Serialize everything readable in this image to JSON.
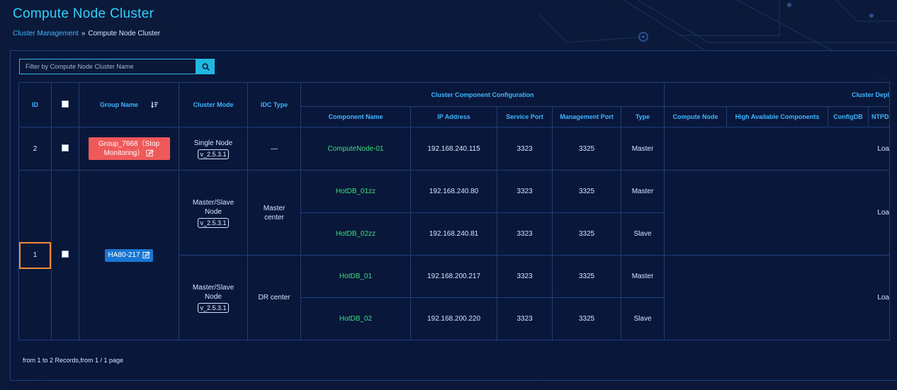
{
  "page": {
    "title": "Compute Node Cluster",
    "breadcrumb": {
      "link": "Cluster Management",
      "separator": "»",
      "current": "Compute Node Cluster"
    }
  },
  "search": {
    "placeholder": "Filter by Compute Node Cluster Name",
    "icon": "search-icon"
  },
  "table": {
    "headers": {
      "id": "ID",
      "group_name": "Group Name",
      "cluster_mode": "Cluster Mode",
      "idc_type": "IDC Type",
      "component_config": "Cluster Component Configuration",
      "component_name": "Component Name",
      "ip_address": "IP Address",
      "service_port": "Service Port",
      "management_port": "Management Port",
      "type": "Type",
      "cluster_deploy": "Cluster Depl",
      "compute_node": "Compute Node",
      "ha_components": "High Available Components",
      "configdb": "ConfigDB",
      "ntpd": "NTPD"
    },
    "row1": {
      "id": "2",
      "group_name": "Group_7668（Stop Monitoring）",
      "mode": "Single Node",
      "version": "v_2.5.3.1",
      "idc": "—",
      "component": {
        "name": "ComputeNode-01",
        "ip": "192.168.240.115",
        "service_port": "3323",
        "mgmt_port": "3325",
        "type": "Master"
      },
      "deploy_text": "Loa"
    },
    "row2": {
      "id": "1",
      "group_name": "HA80-217",
      "centers": [
        {
          "mode": "Master/Slave Node",
          "version": "v_2.5.3.1",
          "idc": "Master center",
          "deploy_text": "Loa",
          "components": [
            {
              "name": "HotDB_01zz",
              "ip": "192.168.240.80",
              "service_port": "3323",
              "mgmt_port": "3325",
              "type": "Master"
            },
            {
              "name": "HotDB_02zz",
              "ip": "192.168.240.81",
              "service_port": "3323",
              "mgmt_port": "3325",
              "type": "Slave"
            }
          ]
        },
        {
          "mode": "Master/Slave Node",
          "version": "v_2.5.3.1",
          "idc": "DR center",
          "deploy_text": "Loa",
          "components": [
            {
              "name": "HotDB_01",
              "ip": "192.168.200.217",
              "service_port": "3323",
              "mgmt_port": "3325",
              "type": "Master"
            },
            {
              "name": "HotDB_02",
              "ip": "192.168.200.220",
              "service_port": "3323",
              "mgmt_port": "3325",
              "type": "Slave"
            }
          ]
        }
      ]
    }
  },
  "footer": {
    "records": "from 1 to 2 Records,from 1 / 1 page"
  },
  "colors": {
    "background": "#0b1a3a",
    "title": "#2fd3ff",
    "header_text": "#3fb6ff",
    "component_name": "#3de07a",
    "stop_badge": "#f0595a",
    "group_badge": "#1976d2",
    "highlight": "#f08c34"
  }
}
